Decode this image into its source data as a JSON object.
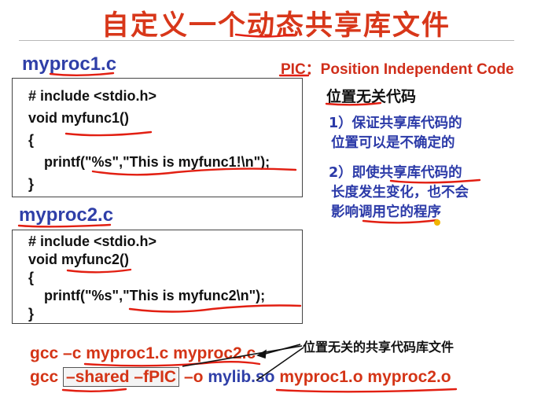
{
  "slide": {
    "title": "自定义一个动态共享库文件",
    "file1": {
      "name": "myproc1.c",
      "lines": [
        "# include <stdio.h>",
        "void myfunc1()",
        "{",
        "    printf(\"%s\",\"This is myfunc1!\\n\");",
        "}"
      ]
    },
    "file2": {
      "name": "myproc2.c",
      "lines": [
        "# include <stdio.h>",
        "void myfunc2()",
        "{",
        "    printf(\"%s\",\"This is myfunc2\\n\");",
        "}"
      ]
    },
    "pic_label": "PIC：Position Independent Code",
    "side": {
      "heading": "位置无关代码",
      "point1_line1": "1）保证共享库代码的",
      "point1_line2": "位置可以是不确定的",
      "point2_line1": "2）即使共享库代码的",
      "point2_line2": "长度发生变化，也不会",
      "point2_line3": "影响调用它的程序"
    },
    "annotation": "位置无关的共享代码库文件",
    "cmd1": {
      "gcc": "gcc",
      "flag": "–c",
      "src1": "myproc1.c",
      "src2": "myproc2.c"
    },
    "cmd2": {
      "gcc": "gcc",
      "shared": "–shared",
      "fpic": "–fPIC",
      "o": "–o",
      "lib": "mylib.so",
      "obj1": "myproc1.o",
      "obj2": "myproc2.o"
    },
    "colors": {
      "title": "#d8371a",
      "blue": "#2f3fa8",
      "red": "#d43416",
      "ink": "#e21f12"
    }
  }
}
